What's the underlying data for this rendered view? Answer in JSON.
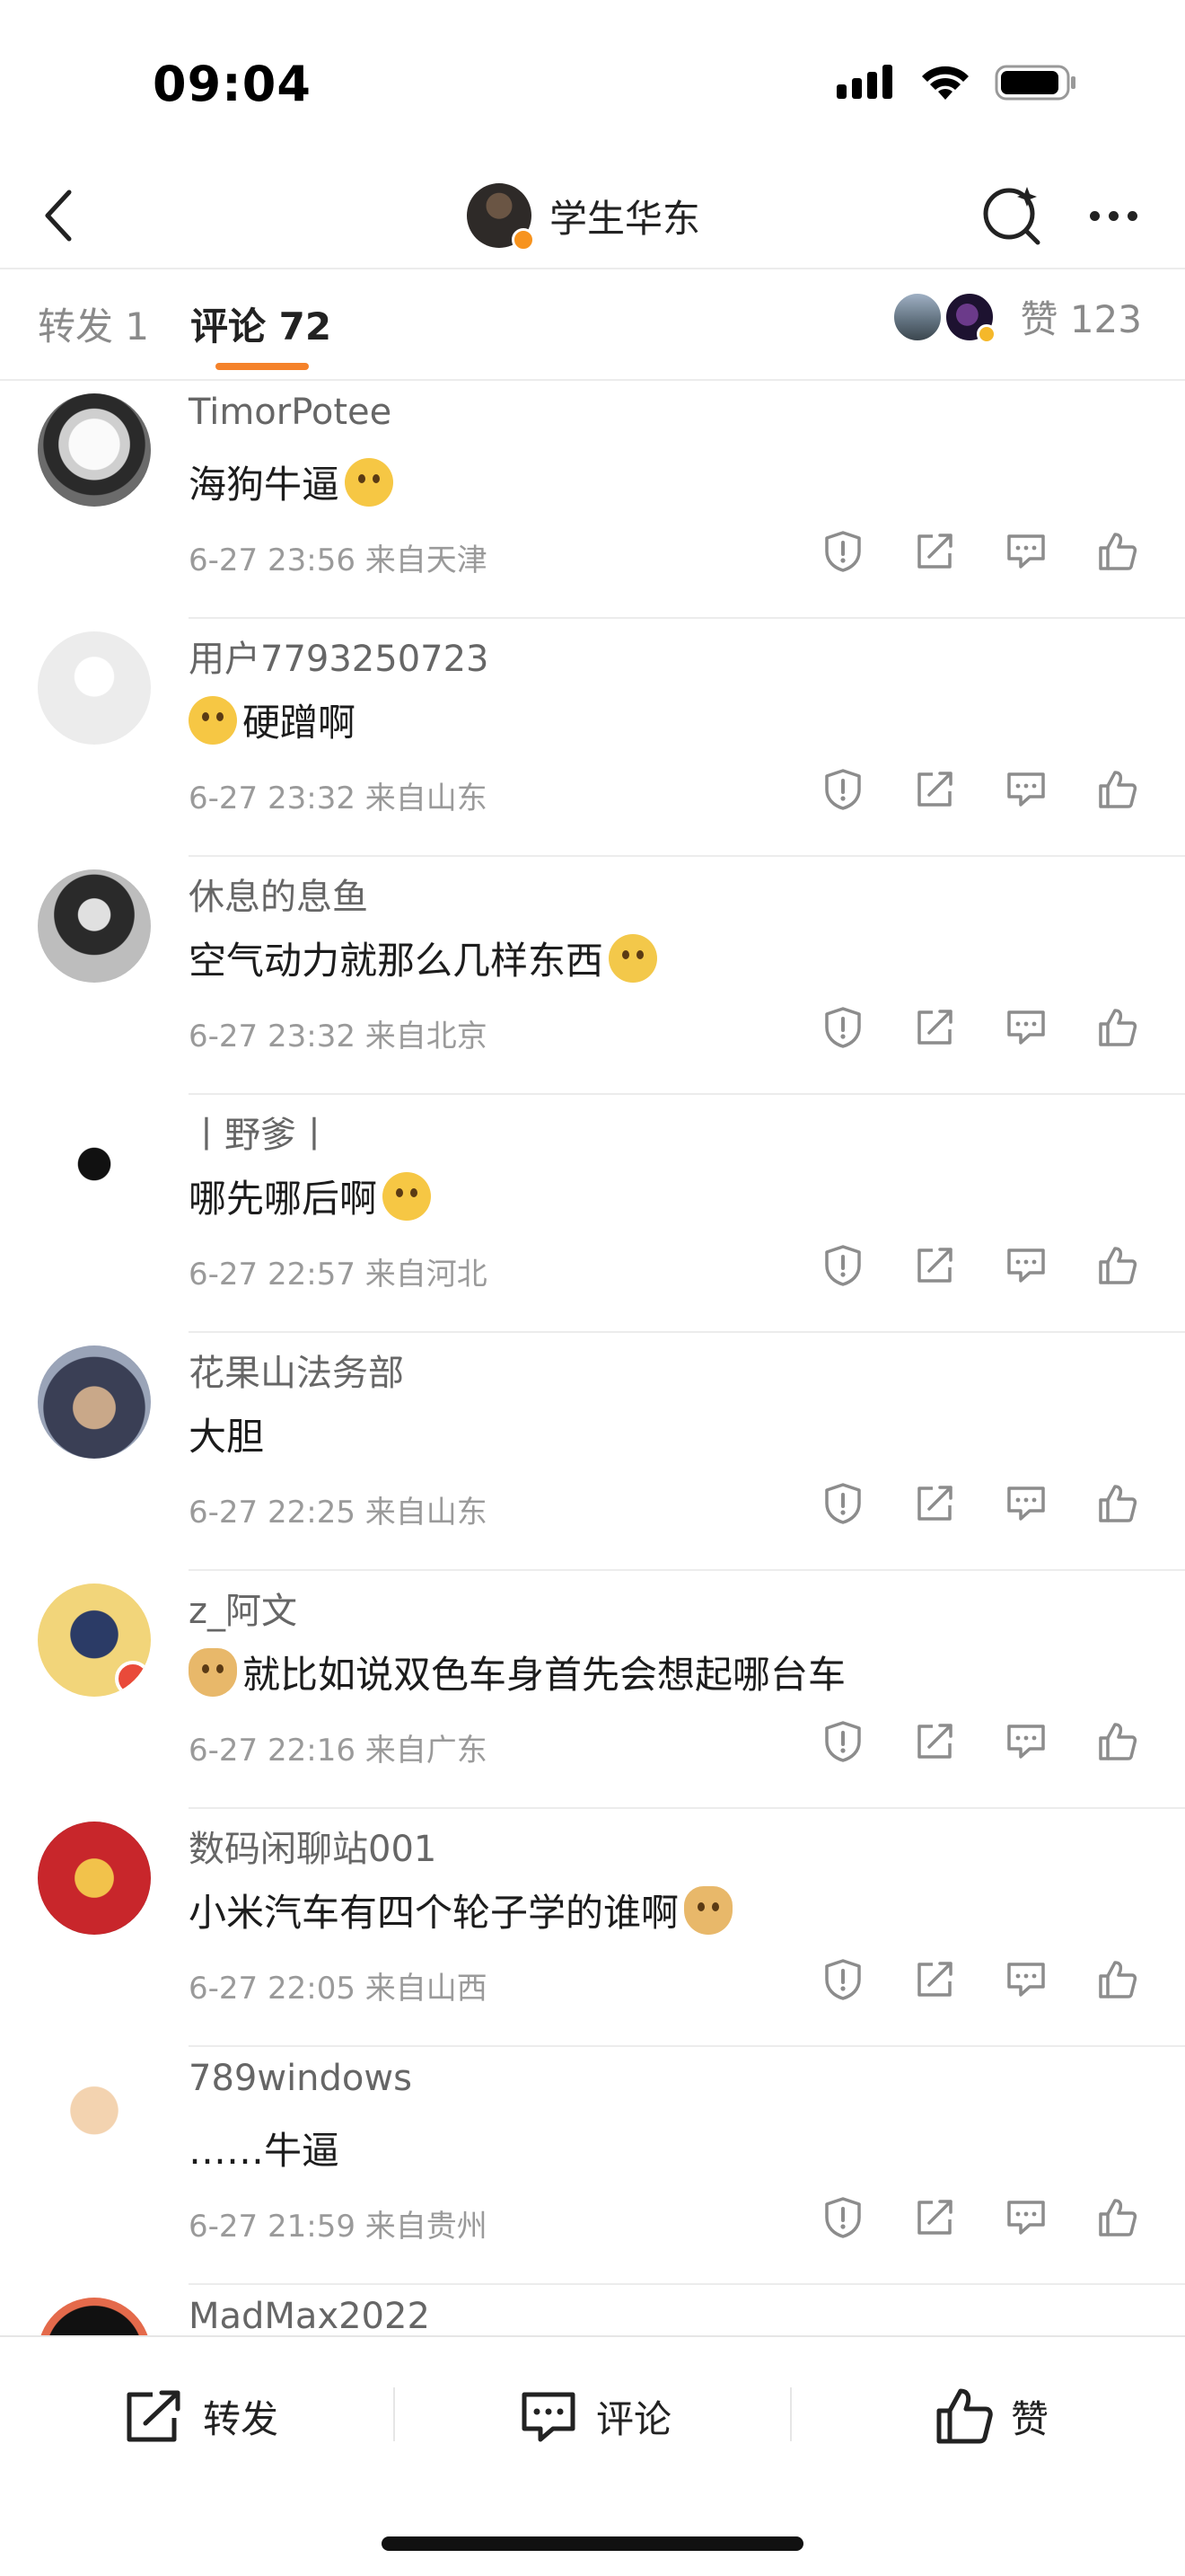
{
  "status_bar": {
    "time": "09:04"
  },
  "header": {
    "title": "学生华东"
  },
  "tabs": {
    "repost": "转发 1",
    "comment": "评论 72",
    "likes": "赞 123"
  },
  "comments": [
    {
      "name": "TimorPotee",
      "text": "海狗牛逼",
      "emoji": "crying-laughing-emoji",
      "emoji_position": "after",
      "meta": "6-27 23:56  来自天津"
    },
    {
      "name": "用户7793250723",
      "text": "硬蹭啊",
      "emoji": "laughing-tears-emoji",
      "emoji_position": "before",
      "meta": "6-27 23:32  来自山东"
    },
    {
      "name": "休息的息鱼",
      "text": "空气动力就那么几样东西",
      "emoji": "shrug-emoji",
      "emoji_position": "after",
      "meta": "6-27 23:32  来自北京"
    },
    {
      "name": "丨野爹丨",
      "text": "哪先哪后啊",
      "emoji": "laughing-tears-emoji",
      "emoji_position": "after",
      "meta": "6-27 22:57  来自河北"
    },
    {
      "name": "花果山法务部",
      "text": "大胆",
      "emoji": "",
      "emoji_position": "",
      "meta": "6-27 22:25  来自山东"
    },
    {
      "name": "z_阿文",
      "text": "就比如说双色车身首先会想起哪台车",
      "emoji": "doge-emoji",
      "emoji_position": "before",
      "meta": "6-27 22:16  来自广东"
    },
    {
      "name": "数码闲聊站001",
      "text": "小米汽车有四个轮子学的谁啊",
      "emoji": "doge-emoji",
      "emoji_position": "after",
      "meta": "6-27 22:05  来自山西"
    },
    {
      "name": "789windows",
      "text": "……牛逼",
      "emoji": "",
      "emoji_position": "",
      "meta": "6-27 21:59  来自贵州"
    },
    {
      "name": "MadMax2022",
      "text": "",
      "emoji": "",
      "emoji_position": "",
      "meta": ""
    }
  ],
  "bottom_bar": {
    "repost": "转发",
    "comment": "评论",
    "like": "赞"
  },
  "colors": {
    "accent": "#f5822a",
    "text_primary": "#1c1c1c",
    "text_secondary": "#9a9a9a"
  }
}
